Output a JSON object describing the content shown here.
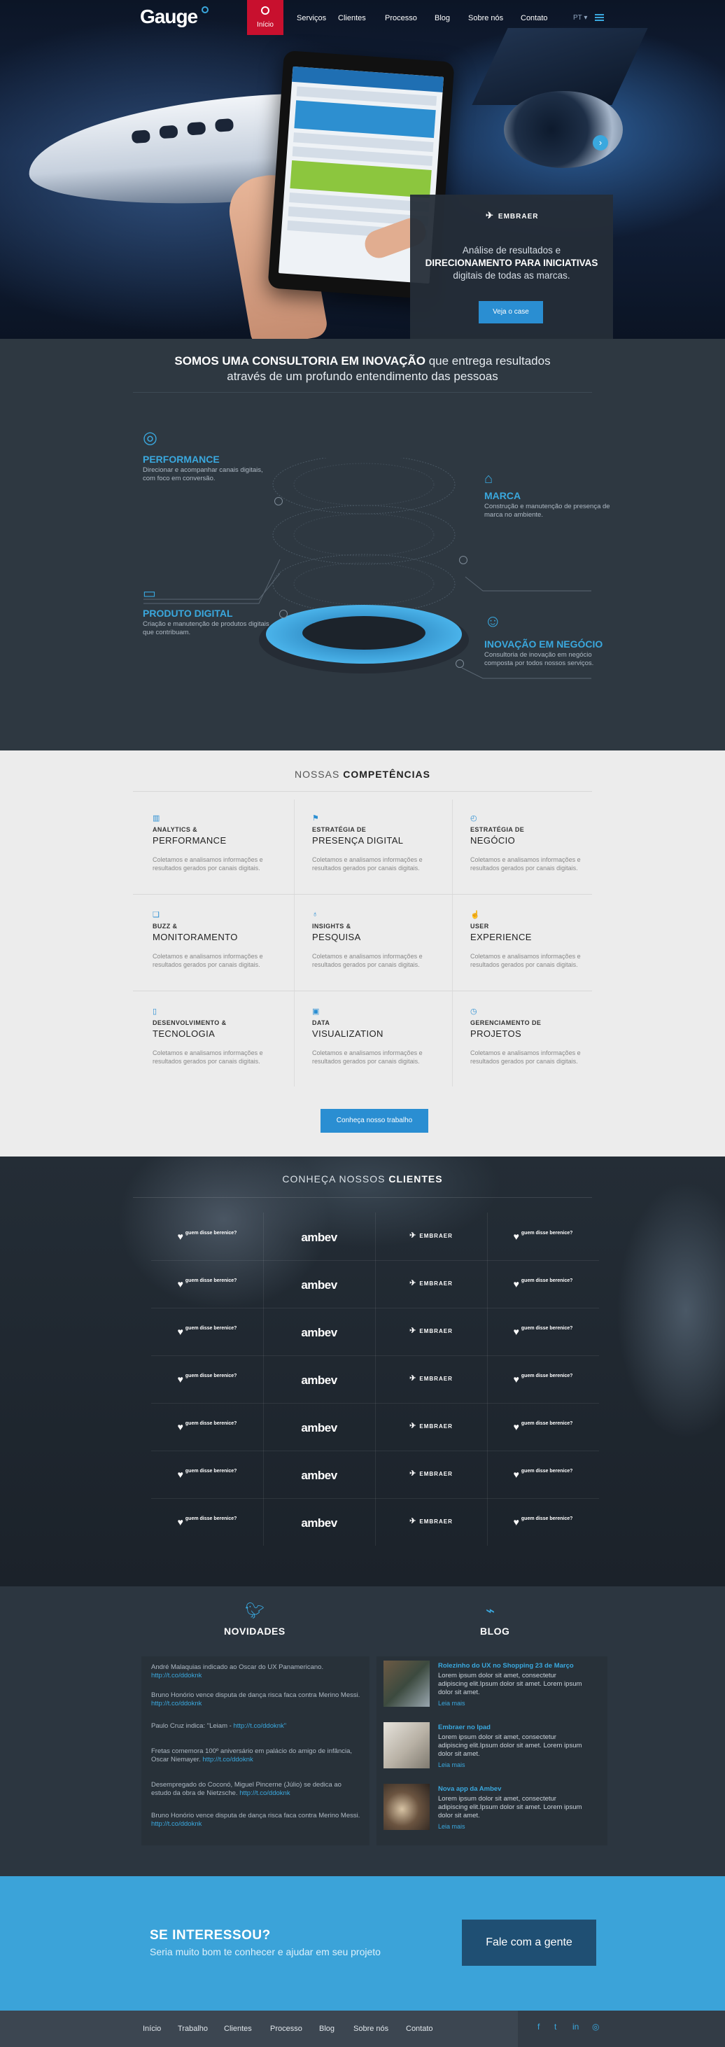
{
  "header": {
    "logo": "Gauge",
    "nav": [
      {
        "label": "Início"
      },
      {
        "label": "Serviços"
      },
      {
        "label": "Clientes"
      },
      {
        "label": "Processo"
      },
      {
        "label": "Blog"
      },
      {
        "label": "Sobre nós"
      },
      {
        "label": "Contato"
      }
    ],
    "lang": "PT",
    "accent": "#c8102e"
  },
  "hero": {
    "card_brand": "EMBRAER",
    "card_line1": "Análise de resultados e",
    "card_line2": "DIRECIONAMENTO PARA INICIATIVAS",
    "card_line3": "digitais de todas as marcas.",
    "card_button": "Veja o case",
    "next_arrow": "›"
  },
  "consult": {
    "headline_bold": "SOMOS UMA CONSULTORIA EM INOVAÇÃO",
    "headline_rest": " que entrega resultados",
    "headline_line2": "através de um profundo entendimento das pessoas",
    "features": [
      {
        "title": "PERFORMANCE",
        "text": "Direcionar e acompanhar canais digitais, com foco em conversão.",
        "icon": "target-icon"
      },
      {
        "title": "MARCA",
        "text": "Construção e manutenção de presença de marca no ambiente.",
        "icon": "tag-icon"
      },
      {
        "title": "PRODUTO DIGITAL",
        "text": "Criação e manutenção de produtos digitais que contribuam.",
        "icon": "monitor-icon"
      },
      {
        "title": "INOVAÇÃO EM NEGÓCIO",
        "text": "Consultoria de inovação em negócio composta por todos nossos serviços.",
        "icon": "head-icon"
      }
    ]
  },
  "competencias": {
    "title_light": "NOSSAS ",
    "title_bold": "COMPETÊNCIAS",
    "items": [
      {
        "small": "ANALYTICS &",
        "big": "PERFORMANCE",
        "desc": "Coletamos e analisamos informações e resultados gerados por canais digitais.",
        "icon": "chart-icon"
      },
      {
        "small": "ESTRATÉGIA DE",
        "big": "PRESENÇA DIGITAL",
        "desc": "Coletamos e analisamos informações e resultados gerados por canais digitais.",
        "icon": "flag-icon"
      },
      {
        "small": "ESTRATÉGIA DE",
        "big": "NEGÓCIO",
        "desc": "Coletamos e analisamos informações e resultados gerados por canais digitais.",
        "icon": "compass-icon"
      },
      {
        "small": "BUZZ &",
        "big": "MONITORAMENTO",
        "desc": "Coletamos e analisamos informações e resultados gerados por canais digitais.",
        "icon": "chat-icon"
      },
      {
        "small": "INSIGHTS &",
        "big": "PESQUISA",
        "desc": "Coletamos e analisamos informações e resultados gerados por canais digitais.",
        "icon": "bulb-icon"
      },
      {
        "small": "USER",
        "big": "EXPERIENCE",
        "desc": "Coletamos e analisamos informações e resultados gerados por canais digitais.",
        "icon": "pointer-icon"
      },
      {
        "small": "DESENVOLVIMENTO &",
        "big": "TECNOLOGIA",
        "desc": "Coletamos e analisamos informações e resultados gerados por canais digitais.",
        "icon": "mobile-icon"
      },
      {
        "small": "DATA",
        "big": "VISUALIZATION",
        "desc": "Coletamos e analisamos informações e resultados gerados por canais digitais.",
        "icon": "screen-icon"
      },
      {
        "small": "GERENCIAMENTO DE",
        "big": "PROJETOS",
        "desc": "Coletamos e analisamos informações e resultados gerados por canais digitais.",
        "icon": "clock-icon"
      }
    ],
    "button": "Conheça nosso trabalho"
  },
  "clients": {
    "title_light": "CONHEÇA NOSSOS ",
    "title_bold": "CLIENTES",
    "row_logos": [
      "guem disse berenice?",
      "ambev",
      "EMBRAER",
      "guem disse berenice?"
    ],
    "rows": 7
  },
  "news": {
    "title": "NOVIDADES",
    "items": [
      {
        "text": "André Malaquias indicado ao Oscar do UX Panamericano.",
        "link": "http://t.co/ddoknk"
      },
      {
        "text": "Bruno Honório vence disputa de dança risca faca contra Merino Messi.",
        "link": "http://t.co/ddoknk"
      },
      {
        "text": "Paulo Cruz indica: \"Leiam - ",
        "link": "http://t.co/ddoknk\""
      },
      {
        "text": "Fretas comemora 100º aniversário em palácio do amigo de infância, Oscar Niemayer. ",
        "link": "http://t.co/ddoknk"
      },
      {
        "text": "Desempregado do Coconó, Miguel Pincerne (Júlio) se dedica ao estudo da obra de Nietzsche. ",
        "link": "http://t.co/ddoknk"
      },
      {
        "text": "Bruno Honório vence disputa de dança risca faca contra Merino Messi.",
        "link": "http://t.co/ddoknk"
      }
    ]
  },
  "blog": {
    "title": "BLOG",
    "posts": [
      {
        "title": "Rolezinho do UX no Shopping 23 de Março",
        "text": "Lorem ipsum dolor sit amet, consectetur adipiscing elit.Ipsum dolor sit amet. Lorem ipsum dolor sit amet.",
        "more": "Leia mais"
      },
      {
        "title": "Embraer no Ipad",
        "text": "Lorem ipsum dolor sit amet, consectetur adipiscing elit.Ipsum dolor sit amet. Lorem ipsum dolor sit amet.",
        "more": "Leia mais"
      },
      {
        "title": "Nova app da Ambev",
        "text": "Lorem ipsum dolor sit amet, consectetur adipiscing elit.Ipsum dolor sit amet. Lorem ipsum dolor sit amet.",
        "more": "Leia mais"
      }
    ]
  },
  "cta": {
    "heading": "SE INTERESSOU?",
    "sub": "Seria muito bom te conhecer e ajudar em seu projeto",
    "button": "Fale com a gente",
    "bg": "#3ba3d9"
  },
  "footer": {
    "nav": [
      {
        "label": "Início"
      },
      {
        "label": "Trabalho"
      },
      {
        "label": "Clientes"
      },
      {
        "label": "Processo"
      },
      {
        "label": "Blog"
      },
      {
        "label": "Sobre nós"
      },
      {
        "label": "Contato"
      }
    ],
    "social": [
      "f",
      "t",
      "in",
      "◎"
    ]
  }
}
